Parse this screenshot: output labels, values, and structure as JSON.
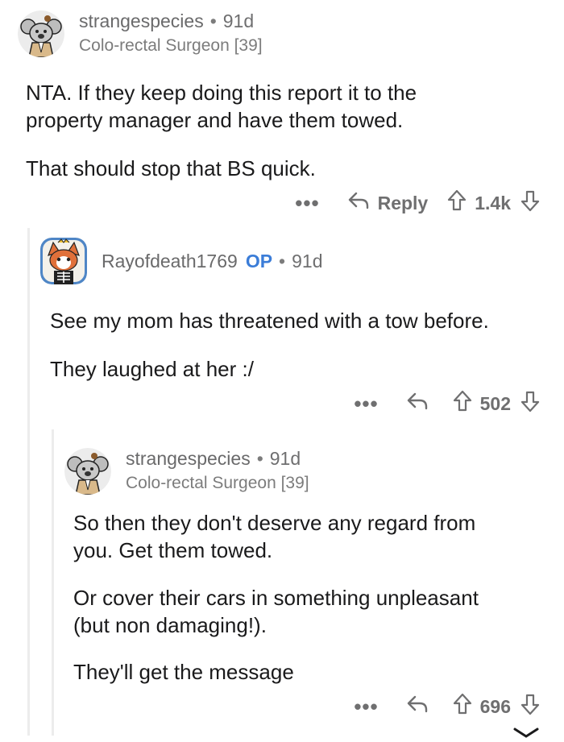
{
  "comments": [
    {
      "username": "strangespecies",
      "op_label": "",
      "separator": "•",
      "age": "91d",
      "flair": "Colo-rectal Surgeon [39]",
      "avatar": "koala-avatar",
      "paragraphs": [
        "NTA. If they keep doing this report it to the",
        "property manager and have them towed.",
        "That should stop that BS quick."
      ],
      "more": "•••",
      "reply_label": "Reply",
      "votes": "1.4k"
    },
    {
      "username": "Rayofdeath1769",
      "op_label": "OP",
      "separator": "•",
      "age": "91d",
      "flair": "",
      "avatar": "fox-skeleton-avatar",
      "paragraphs": [
        "See my mom has threatened with a tow before.",
        "They laughed at her :/"
      ],
      "more": "•••",
      "reply_label": "",
      "votes": "502"
    },
    {
      "username": "strangespecies",
      "op_label": "",
      "separator": "•",
      "age": "91d",
      "flair": "Colo-rectal Surgeon [39]",
      "avatar": "koala-avatar",
      "paragraphs": [
        "So then they don't deserve any regard from",
        "you. Get them towed.",
        "Or cover their cars in something unpleasant",
        "(but non damaging!).",
        "They'll get the message"
      ],
      "more": "•••",
      "reply_label": "",
      "votes": "696"
    }
  ],
  "colors": {
    "op": "#3b7dd8",
    "meta": "#6f6f70",
    "text": "#1a1a1b",
    "thread_line": "#ececec"
  }
}
